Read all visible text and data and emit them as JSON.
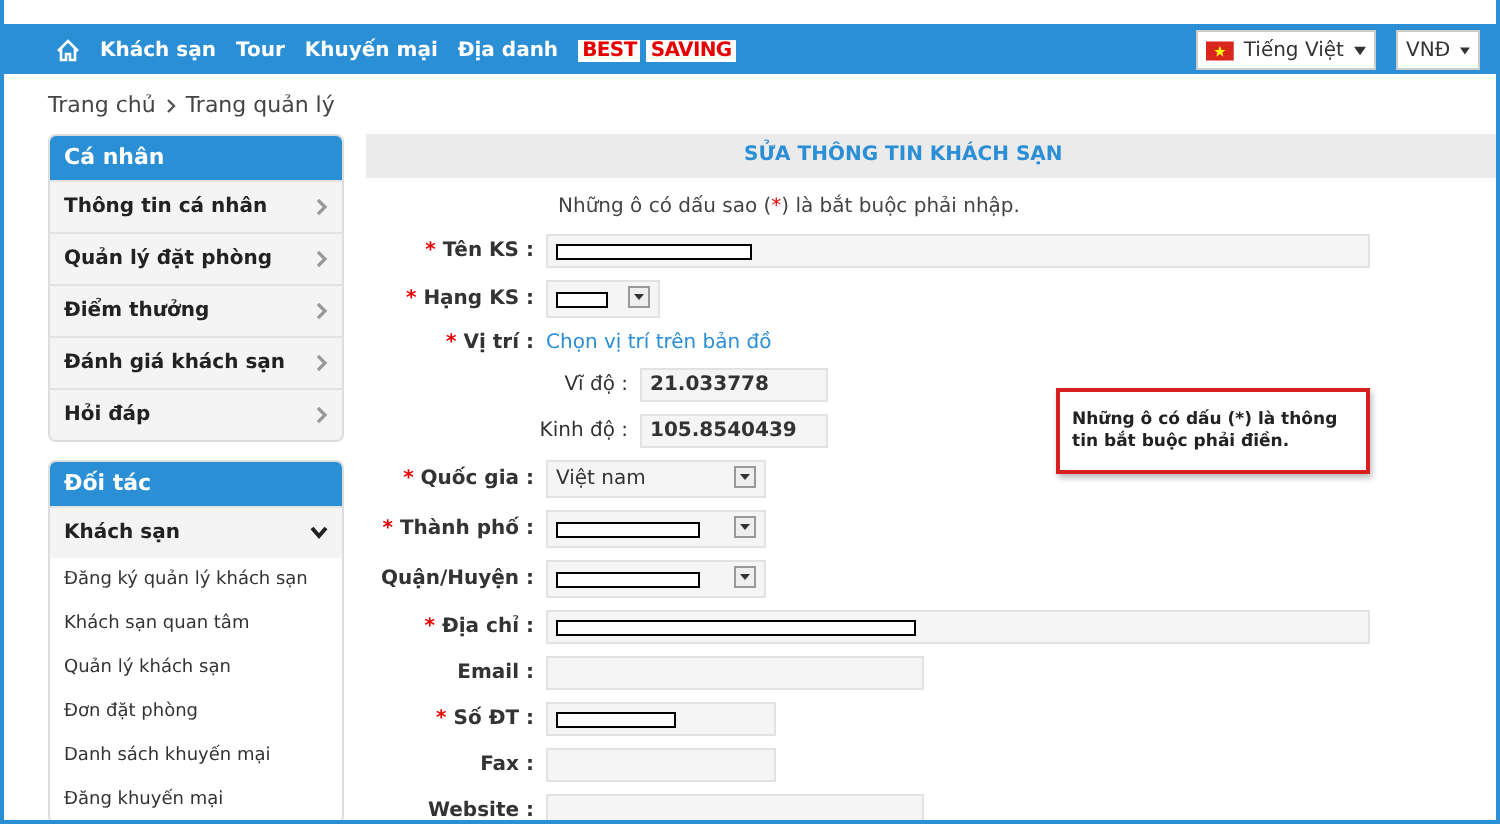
{
  "nav": {
    "items": [
      {
        "label": "Khách sạn"
      },
      {
        "label": "Tour"
      },
      {
        "label": "Khuyến mại"
      },
      {
        "label": "Địa danh"
      }
    ],
    "promo": [
      "BEST",
      "SAVING"
    ],
    "language": "Tiếng Việt",
    "currency": "VNĐ"
  },
  "breadcrumb": [
    "Trang chủ",
    "Trang quản lý"
  ],
  "sidebar": [
    {
      "title": "Cá nhân",
      "items": [
        {
          "label": "Thông tin cá nhân",
          "expanded": false
        },
        {
          "label": "Quản lý đặt phòng",
          "expanded": false
        },
        {
          "label": "Điểm thưởng",
          "expanded": false
        },
        {
          "label": "Đánh giá khách sạn",
          "expanded": false
        },
        {
          "label": "Hỏi đáp",
          "expanded": false
        }
      ]
    },
    {
      "title": "Đối tác",
      "items": [
        {
          "label": "Khách sạn",
          "expanded": true,
          "children": [
            {
              "label": "Đăng ký quản lý khách sạn"
            },
            {
              "label": "Khách sạn quan tâm"
            },
            {
              "label": "Quản lý khách sạn"
            },
            {
              "label": "Đơn đặt phòng"
            },
            {
              "label": "Danh sách khuyến mại"
            },
            {
              "label": "Đăng khuyến mại"
            }
          ]
        }
      ]
    }
  ],
  "form": {
    "title": "SỬA THÔNG TIN KHÁCH SẠN",
    "note": [
      "Những ô có dấu sao (",
      "*",
      ") là bắt buộc phải nhập."
    ],
    "rows": [
      {
        "kind": "text",
        "label": "Tên KS :",
        "required": true,
        "redacted": true
      },
      {
        "kind": "select",
        "label": "Hạng KS :",
        "required": true,
        "redacted": true
      },
      {
        "kind": "link",
        "label": "Vị trí :",
        "required": true,
        "link": "Chọn vị trí trên bản đồ"
      },
      {
        "kind": "sub",
        "label": "Vĩ độ :",
        "value": "21.033778"
      },
      {
        "kind": "sub",
        "label": "Kinh độ :",
        "value": "105.8540439"
      },
      {
        "kind": "select",
        "label": "Quốc gia :",
        "required": true,
        "value": "Việt nam",
        "redacted": false
      },
      {
        "kind": "select",
        "label": "Thành phố :",
        "required": true,
        "redacted": true
      },
      {
        "kind": "select",
        "label": "Quận/Huyện :",
        "required": false,
        "redacted": true
      },
      {
        "kind": "text",
        "label": "Địa chỉ :",
        "required": true,
        "redacted": true
      },
      {
        "kind": "text",
        "label": "Email :",
        "required": false,
        "redacted": false
      },
      {
        "kind": "text",
        "label": "Số ĐT :",
        "required": true,
        "redacted": true
      },
      {
        "kind": "text",
        "label": "Fax :",
        "required": false,
        "redacted": false
      },
      {
        "kind": "text",
        "label": "Website :",
        "required": false,
        "redacted": false
      }
    ]
  },
  "callout": "Những ô có dấu (*) là thông tin bắt buộc phải điền."
}
